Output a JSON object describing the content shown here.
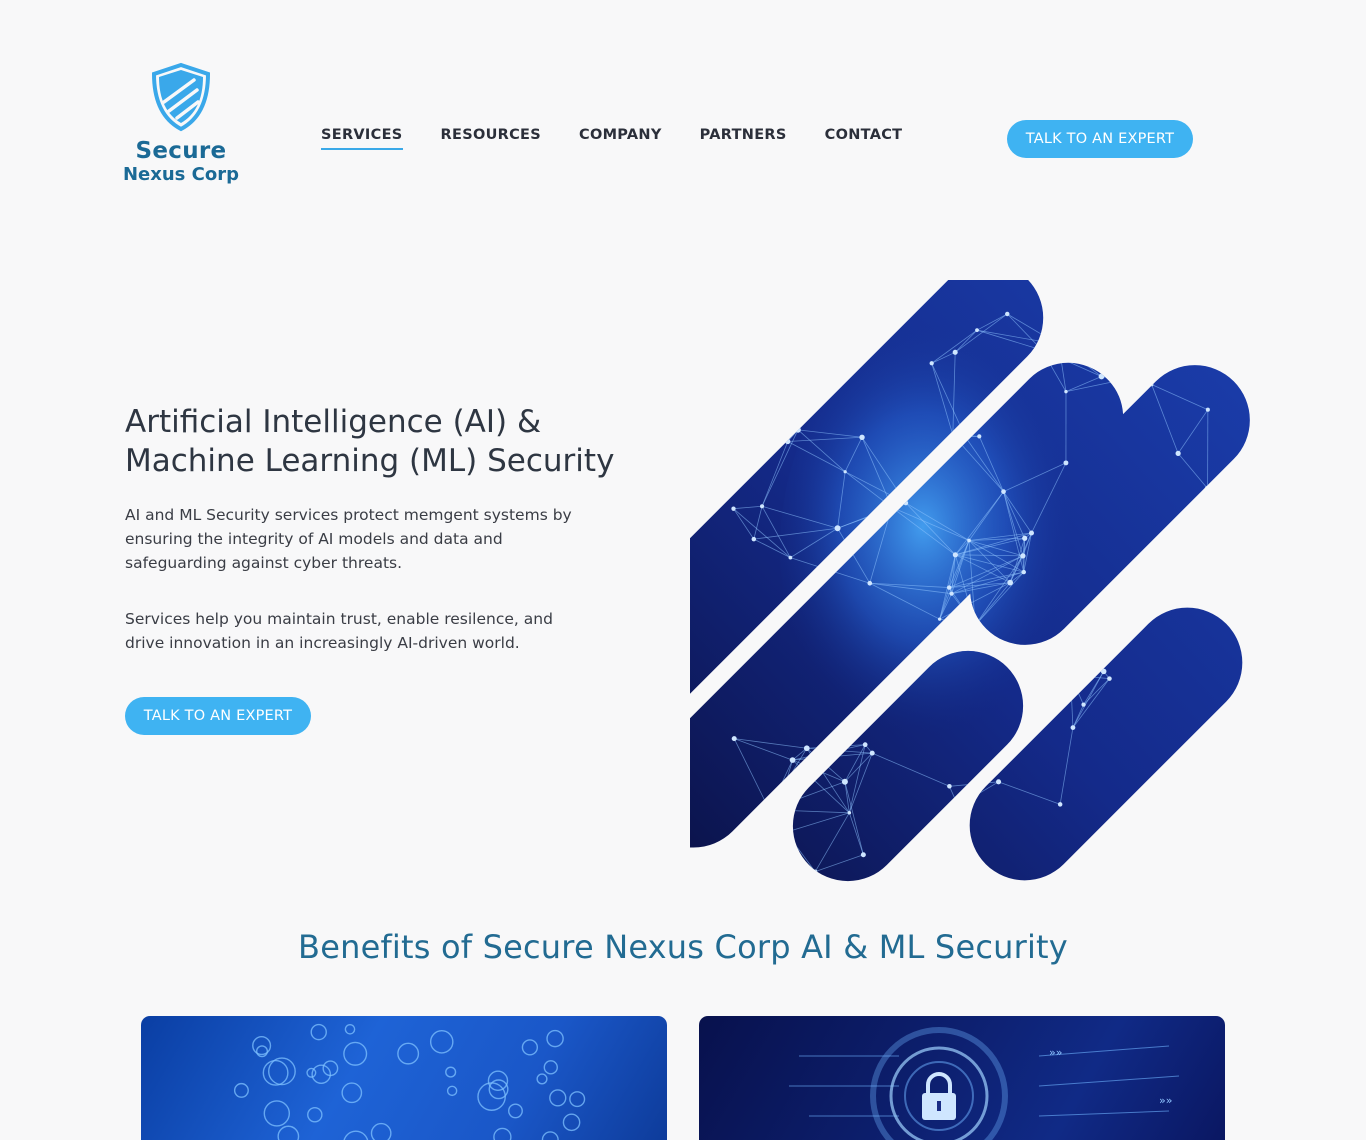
{
  "header": {
    "logo": {
      "line1": "Secure",
      "line2": "Nexus Corp",
      "icon": "shield-icon"
    },
    "nav": [
      {
        "label": "SERVICES",
        "active": true
      },
      {
        "label": "RESOURCES",
        "active": false
      },
      {
        "label": "COMPANY",
        "active": false
      },
      {
        "label": "PARTNERS",
        "active": false
      },
      {
        "label": "CONTACT",
        "active": false
      }
    ],
    "cta_label": "TALK TO AN EXPERT"
  },
  "hero": {
    "title_line1": "Artificial Intelligence (AI) &",
    "title_line2": "Machine Learning (ML) Security",
    "paragraph1": "AI and ML Security services protect memgent systems by ensuring the integrity of AI models and data and safeguarding against cyber threats.",
    "paragraph2": "Services help you maintain trust, enable resilence, and drive innovation in an increasingly AI-driven world.",
    "cta_label": "TALK TO AN EXPERT"
  },
  "benefits": {
    "title": "Benefits of Secure Nexus Corp AI & ML Security"
  },
  "colors": {
    "accent": "#3fb3f2",
    "brand": "#1b6a96",
    "heading": "#226b92",
    "background": "#f8f8f9"
  }
}
